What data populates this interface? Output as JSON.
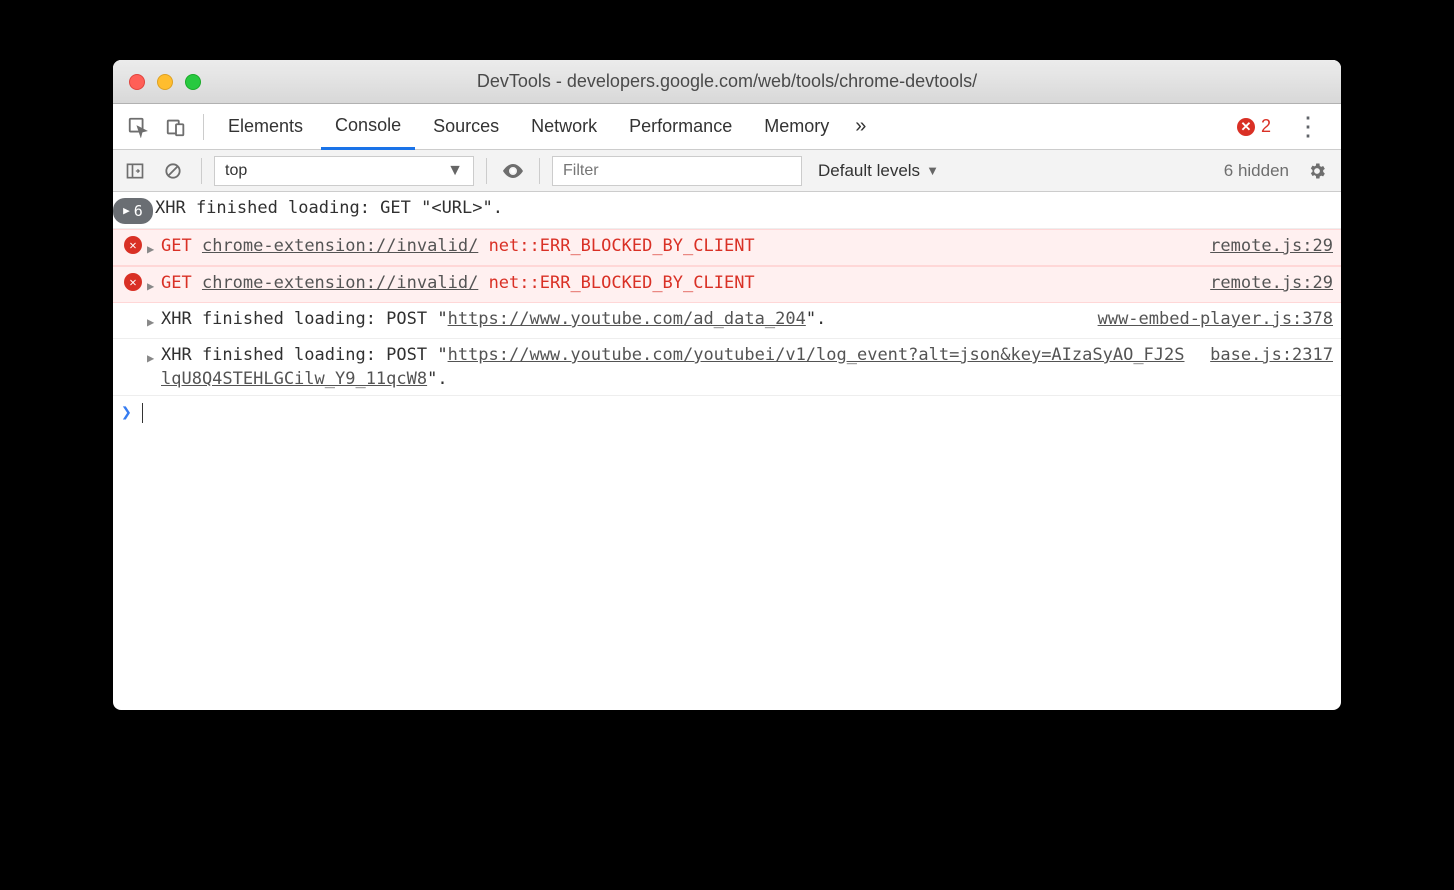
{
  "window": {
    "title": "DevTools - developers.google.com/web/tools/chrome-devtools/"
  },
  "tabs": {
    "items": [
      "Elements",
      "Console",
      "Sources",
      "Network",
      "Performance",
      "Memory"
    ],
    "active": "Console",
    "overflow": "»",
    "error_count": "2",
    "more": "⋮"
  },
  "toolbar": {
    "context": "top",
    "filter_placeholder": "Filter",
    "levels": "Default levels",
    "hidden": "6 hidden"
  },
  "console": {
    "rows": [
      {
        "type": "group",
        "pill_count": "6",
        "text": "XHR finished loading: GET \"<URL>\"."
      },
      {
        "type": "error",
        "method": "GET",
        "url": "chrome-extension://invalid/",
        "errtext": "net::ERR_BLOCKED_BY_CLIENT",
        "source": "remote.js:29"
      },
      {
        "type": "error",
        "method": "GET",
        "url": "chrome-extension://invalid/",
        "errtext": "net::ERR_BLOCKED_BY_CLIENT",
        "source": "remote.js:29"
      },
      {
        "type": "log",
        "prefix": "XHR finished loading: POST \"",
        "url": "https://www.youtube.com/ad_data_204",
        "suffix": "\".",
        "source": "www-embed-player.js:378"
      },
      {
        "type": "log",
        "prefix": "XHR finished loading: POST \"",
        "url": "https://www.youtube.com/youtubei/v1/log_event?alt=json&key=AIzaSyAO_FJ2SlqU8Q4STEHLGCilw_Y9_11qcW8",
        "suffix": "\".",
        "source": "base.js:2317"
      }
    ],
    "prompt": "❯"
  }
}
